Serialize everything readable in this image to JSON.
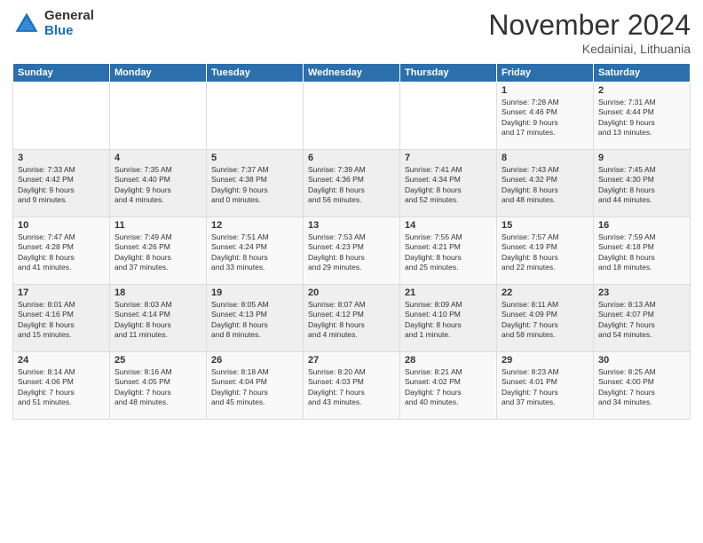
{
  "logo": {
    "general": "General",
    "blue": "Blue"
  },
  "header": {
    "month": "November 2024",
    "location": "Kedainiai, Lithuania"
  },
  "weekdays": [
    "Sunday",
    "Monday",
    "Tuesday",
    "Wednesday",
    "Thursday",
    "Friday",
    "Saturday"
  ],
  "weeks": [
    [
      {
        "day": "",
        "info": ""
      },
      {
        "day": "",
        "info": ""
      },
      {
        "day": "",
        "info": ""
      },
      {
        "day": "",
        "info": ""
      },
      {
        "day": "",
        "info": ""
      },
      {
        "day": "1",
        "info": "Sunrise: 7:28 AM\nSunset: 4:46 PM\nDaylight: 9 hours\nand 17 minutes."
      },
      {
        "day": "2",
        "info": "Sunrise: 7:31 AM\nSunset: 4:44 PM\nDaylight: 9 hours\nand 13 minutes."
      }
    ],
    [
      {
        "day": "3",
        "info": "Sunrise: 7:33 AM\nSunset: 4:42 PM\nDaylight: 9 hours\nand 9 minutes."
      },
      {
        "day": "4",
        "info": "Sunrise: 7:35 AM\nSunset: 4:40 PM\nDaylight: 9 hours\nand 4 minutes."
      },
      {
        "day": "5",
        "info": "Sunrise: 7:37 AM\nSunset: 4:38 PM\nDaylight: 9 hours\nand 0 minutes."
      },
      {
        "day": "6",
        "info": "Sunrise: 7:39 AM\nSunset: 4:36 PM\nDaylight: 8 hours\nand 56 minutes."
      },
      {
        "day": "7",
        "info": "Sunrise: 7:41 AM\nSunset: 4:34 PM\nDaylight: 8 hours\nand 52 minutes."
      },
      {
        "day": "8",
        "info": "Sunrise: 7:43 AM\nSunset: 4:32 PM\nDaylight: 8 hours\nand 48 minutes."
      },
      {
        "day": "9",
        "info": "Sunrise: 7:45 AM\nSunset: 4:30 PM\nDaylight: 8 hours\nand 44 minutes."
      }
    ],
    [
      {
        "day": "10",
        "info": "Sunrise: 7:47 AM\nSunset: 4:28 PM\nDaylight: 8 hours\nand 41 minutes."
      },
      {
        "day": "11",
        "info": "Sunrise: 7:49 AM\nSunset: 4:26 PM\nDaylight: 8 hours\nand 37 minutes."
      },
      {
        "day": "12",
        "info": "Sunrise: 7:51 AM\nSunset: 4:24 PM\nDaylight: 8 hours\nand 33 minutes."
      },
      {
        "day": "13",
        "info": "Sunrise: 7:53 AM\nSunset: 4:23 PM\nDaylight: 8 hours\nand 29 minutes."
      },
      {
        "day": "14",
        "info": "Sunrise: 7:55 AM\nSunset: 4:21 PM\nDaylight: 8 hours\nand 25 minutes."
      },
      {
        "day": "15",
        "info": "Sunrise: 7:57 AM\nSunset: 4:19 PM\nDaylight: 8 hours\nand 22 minutes."
      },
      {
        "day": "16",
        "info": "Sunrise: 7:59 AM\nSunset: 4:18 PM\nDaylight: 8 hours\nand 18 minutes."
      }
    ],
    [
      {
        "day": "17",
        "info": "Sunrise: 8:01 AM\nSunset: 4:16 PM\nDaylight: 8 hours\nand 15 minutes."
      },
      {
        "day": "18",
        "info": "Sunrise: 8:03 AM\nSunset: 4:14 PM\nDaylight: 8 hours\nand 11 minutes."
      },
      {
        "day": "19",
        "info": "Sunrise: 8:05 AM\nSunset: 4:13 PM\nDaylight: 8 hours\nand 8 minutes."
      },
      {
        "day": "20",
        "info": "Sunrise: 8:07 AM\nSunset: 4:12 PM\nDaylight: 8 hours\nand 4 minutes."
      },
      {
        "day": "21",
        "info": "Sunrise: 8:09 AM\nSunset: 4:10 PM\nDaylight: 8 hours\nand 1 minute."
      },
      {
        "day": "22",
        "info": "Sunrise: 8:11 AM\nSunset: 4:09 PM\nDaylight: 7 hours\nand 58 minutes."
      },
      {
        "day": "23",
        "info": "Sunrise: 8:13 AM\nSunset: 4:07 PM\nDaylight: 7 hours\nand 54 minutes."
      }
    ],
    [
      {
        "day": "24",
        "info": "Sunrise: 8:14 AM\nSunset: 4:06 PM\nDaylight: 7 hours\nand 51 minutes."
      },
      {
        "day": "25",
        "info": "Sunrise: 8:16 AM\nSunset: 4:05 PM\nDaylight: 7 hours\nand 48 minutes."
      },
      {
        "day": "26",
        "info": "Sunrise: 8:18 AM\nSunset: 4:04 PM\nDaylight: 7 hours\nand 45 minutes."
      },
      {
        "day": "27",
        "info": "Sunrise: 8:20 AM\nSunset: 4:03 PM\nDaylight: 7 hours\nand 43 minutes."
      },
      {
        "day": "28",
        "info": "Sunrise: 8:21 AM\nSunset: 4:02 PM\nDaylight: 7 hours\nand 40 minutes."
      },
      {
        "day": "29",
        "info": "Sunrise: 8:23 AM\nSunset: 4:01 PM\nDaylight: 7 hours\nand 37 minutes."
      },
      {
        "day": "30",
        "info": "Sunrise: 8:25 AM\nSunset: 4:00 PM\nDaylight: 7 hours\nand 34 minutes."
      }
    ]
  ]
}
